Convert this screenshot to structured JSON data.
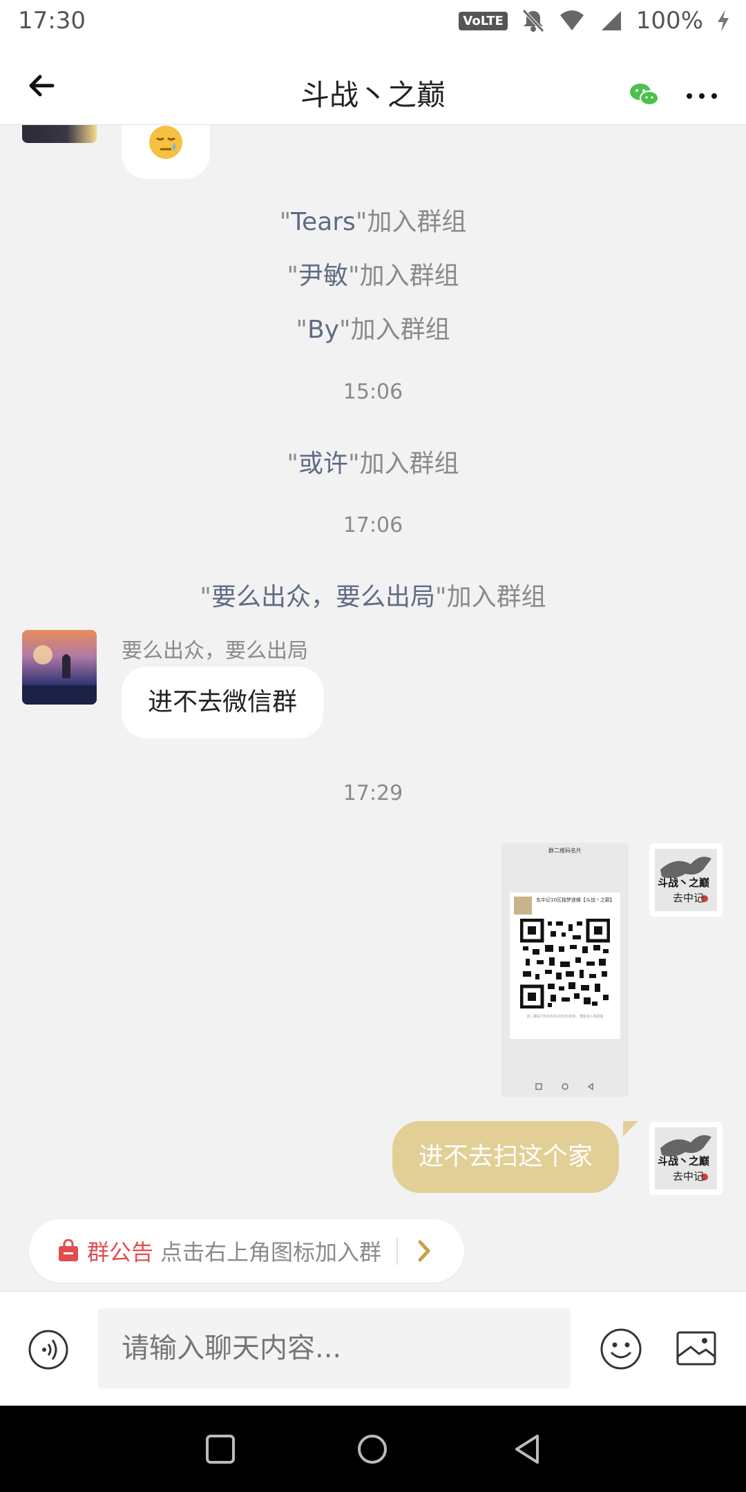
{
  "status_bar": {
    "time": "17:30",
    "volte": "VoLTE",
    "battery": "100%"
  },
  "nav": {
    "title": "斗战丶之巅"
  },
  "system_messages": [
    {
      "name": "Tears",
      "suffix": "加入群组"
    },
    {
      "name": "尹敏",
      "suffix": "加入群组"
    },
    {
      "name": "By",
      "suffix": "加入群组"
    },
    {
      "name": "或许",
      "suffix": "加入群组"
    },
    {
      "name": "要么出众，要么出局",
      "suffix": "加入群组"
    }
  ],
  "timestamps": [
    "15:06",
    "17:06",
    "17:29"
  ],
  "messages": {
    "incoming_sender": "要么出众，要么出局",
    "incoming_text": "进不去微信群",
    "outgoing_text": "进不去扫这个家"
  },
  "avatar_text": {
    "line1": "斗战丶之巅",
    "line2": "去中记"
  },
  "shared_image": {
    "header": "群二维码名片",
    "group_name": "玄中记10区独梦迷蝶【斗战丶之巅】",
    "footer": "该二维码7天内(8月19日前)有效，重新进入将更新"
  },
  "notice": {
    "tag": "群公告",
    "text": "点击右上角图标加入群"
  },
  "input": {
    "placeholder": "请输入聊天内容..."
  },
  "colors": {
    "accent_gold": "#e2cf96",
    "notice_red": "#e24d4d",
    "wechat_green": "#4cc14c"
  }
}
